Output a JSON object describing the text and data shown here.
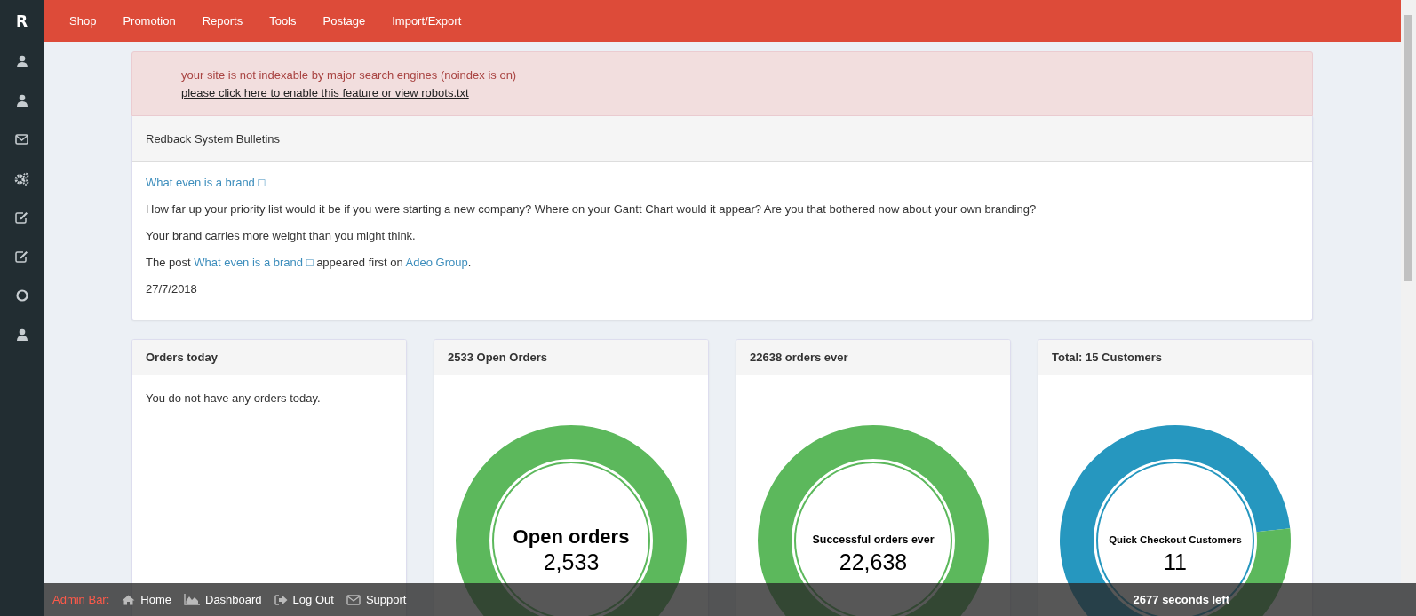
{
  "sidebar": {
    "logo": "R"
  },
  "top_nav": [
    "Shop",
    "Promotion",
    "Reports",
    "Tools",
    "Postage",
    "Import/Export"
  ],
  "alert": {
    "message": "your site is not indexable by major search engines (noindex is on)",
    "link": "please click here to enable this feature or view robots.txt"
  },
  "bulletins": {
    "title": "Redback System Bulletins",
    "post_title": "What even is a brand □",
    "paragraphs": [
      "How far up your priority list would it be if you were starting a new company? Where on your Gantt Chart would it appear? Are you that bothered now about your own branding?",
      "Your brand carries more weight than you might think."
    ],
    "post_line": {
      "before": "The post",
      "link": "What even is a brand □",
      "middle": "appeared first on",
      "source": "Adeo Group",
      "after": "."
    },
    "date": "27/7/2018"
  },
  "cards": [
    {
      "kind": "text",
      "title": "Orders today",
      "text": "You do not have any orders today."
    },
    {
      "kind": "ring",
      "title": "2533 Open Orders",
      "center_label": "Open orders",
      "center_value": "2,533"
    },
    {
      "kind": "ring",
      "title": "22638 orders ever",
      "center_label": "Successful orders ever",
      "center_value": "22,638"
    },
    {
      "kind": "donut",
      "title": "Total: 15 Customers",
      "center_label": "Quick Checkout Customers",
      "center_value": "11",
      "chart_data": {
        "type": "donut",
        "values": [
          73.3,
          26.7
        ]
      }
    }
  ],
  "admin_bar": {
    "label": "Admin Bar:",
    "links": [
      "Home",
      "Dashboard",
      "Log Out",
      "Support"
    ],
    "timer": "2677 seconds left"
  }
}
